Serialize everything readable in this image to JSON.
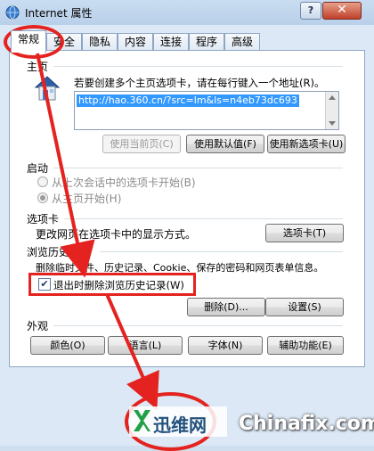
{
  "window": {
    "title": "Internet 属性",
    "help_label": "?",
    "close_label": "✕"
  },
  "tabs": [
    {
      "label": "常规",
      "active": true
    },
    {
      "label": "安全"
    },
    {
      "label": "隐私"
    },
    {
      "label": "内容"
    },
    {
      "label": "连接"
    },
    {
      "label": "程序"
    },
    {
      "label": "高级"
    }
  ],
  "home": {
    "group_label": "主页",
    "instruction": "若要创建多个主页选项卡，请在每行键入一个地址(R)。",
    "url_value": "http://hao.360.cn/?src=lm&ls=n4eb73dc693",
    "btn_use_current": "使用当前页(C)",
    "btn_use_default": "使用默认值(F)",
    "btn_use_new_tab": "使用新选项卡(U)"
  },
  "startup": {
    "group_label": "启动",
    "option_last_session": "从上次会话中的选项卡开始(B)",
    "option_homepage": "从主页开始(H)"
  },
  "tabs_group": {
    "group_label": "选项卡",
    "description": "更改网页在选项卡中的显示方式。",
    "btn_tabs": "选项卡(T)"
  },
  "history": {
    "group_label": "浏览历史记录",
    "description": "删除临时文件、历史记录、Cookie、保存的密码和网页表单信息。",
    "checkbox_label": "退出时删除浏览历史记录(W)",
    "checkbox_checked": true,
    "btn_delete": "删除(D)...",
    "btn_settings": "设置(S)"
  },
  "appearance": {
    "group_label": "外观",
    "btn_colors": "颜色(O)",
    "btn_languages": "语言(L)",
    "btn_fonts": "字体(N)",
    "btn_accessibility": "辅助功能(E)"
  },
  "watermark": {
    "cn": "迅维网",
    "en": "Chinafix.com"
  },
  "colors": {
    "highlight": "#e42320",
    "selection": "#3399ff"
  }
}
